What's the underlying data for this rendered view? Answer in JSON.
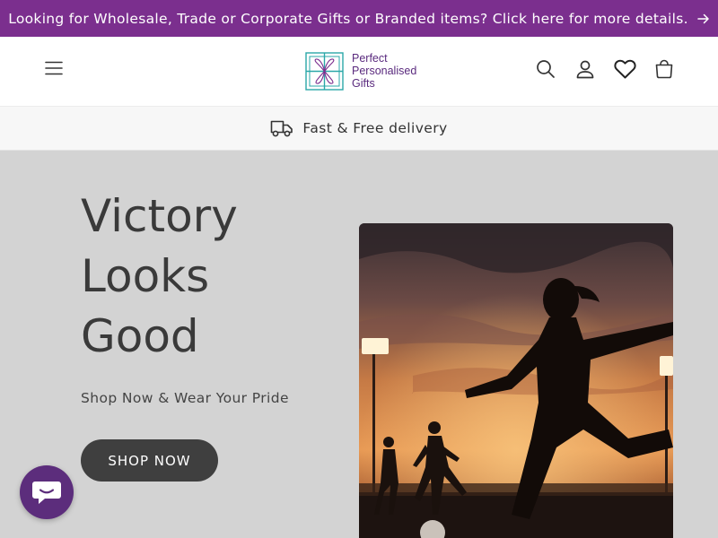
{
  "announcement": {
    "text": "Looking for Wholesale, Trade or Corporate Gifts or Branded items? Click here for more details."
  },
  "header": {
    "logo": {
      "line1": "Perfect",
      "line2": "Personalised",
      "line3": "Gifts"
    }
  },
  "delivery": {
    "text": "Fast & Free delivery"
  },
  "hero": {
    "title_lines": [
      "Victory",
      "Looks",
      "Good"
    ],
    "subtitle": "Shop Now & Wear Your Pride",
    "button_label": "SHOP NOW"
  },
  "colors": {
    "announcement_bg": "#7b2f8e",
    "hero_bg": "#d3d3d3",
    "button_bg": "#3f3f3f",
    "chat_bg": "#5c2d7c",
    "logo_text": "#5a2a7e"
  },
  "icons": [
    "arrow-right-icon",
    "menu-icon",
    "search-icon",
    "account-icon",
    "heart-icon",
    "cart-icon",
    "truck-icon",
    "chat-icon"
  ]
}
